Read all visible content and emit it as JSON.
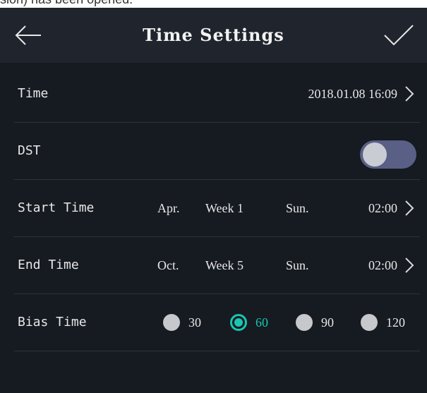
{
  "header": {
    "title": "Time Settings",
    "back_icon": "arrow-left-icon",
    "confirm_icon": "checkmark-icon"
  },
  "cropped_top_text": "sion) has been opened.",
  "rows": {
    "time": {
      "label": "Time",
      "value": "2018.01.08  16:09"
    },
    "dst": {
      "label": "DST",
      "enabled": false
    },
    "start_time": {
      "label": "Start Time",
      "month": "Apr.",
      "week": "Week 1",
      "day": "Sun.",
      "time": "02:00"
    },
    "end_time": {
      "label": "End Time",
      "month": "Oct.",
      "week": "Week 5",
      "day": "Sun.",
      "time": "02:00"
    },
    "bias_time": {
      "label": "Bias Time",
      "options": [
        "30",
        "60",
        "90",
        "120"
      ],
      "selected": "60"
    }
  },
  "colors": {
    "background": "#161a21",
    "header": "#20252d",
    "accent": "#19c6b0",
    "toggle_track": "#5a5f86"
  }
}
